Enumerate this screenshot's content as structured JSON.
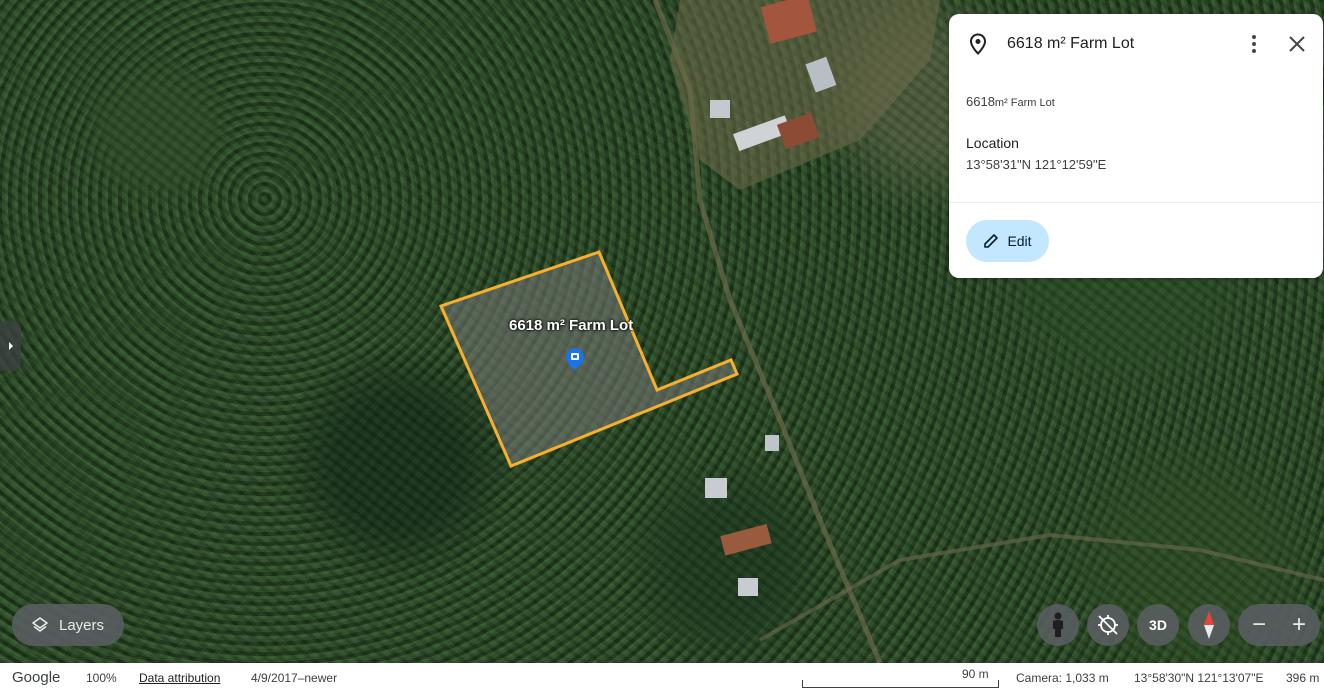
{
  "map": {
    "parcel_label": "6618 m² Farm Lot"
  },
  "panel": {
    "title": "6618 m² Farm Lot",
    "desc_number": "6618",
    "desc_rest": "m² Farm Lot",
    "location_label": "Location",
    "location_value": "13°58'31\"N 121°12'59\"E",
    "edit_label": "Edit"
  },
  "controls": {
    "layers_label": "Layers",
    "three_d_label": "3D",
    "zoom_out": "−",
    "zoom_in": "+"
  },
  "statusbar": {
    "brand": "Google",
    "zoom": "100%",
    "attribution": "Data attribution",
    "imagery_date": "4/9/2017–newer",
    "scale_label": "90 m",
    "camera": "Camera: 1,033 m",
    "coordinates": "13°58'30\"N 121°13'07\"E",
    "elevation": "396 m"
  },
  "colors": {
    "parcel_outline": "#f6b02e",
    "edit_button_bg": "#c2e7ff",
    "pin_blue": "#1a73e8"
  }
}
